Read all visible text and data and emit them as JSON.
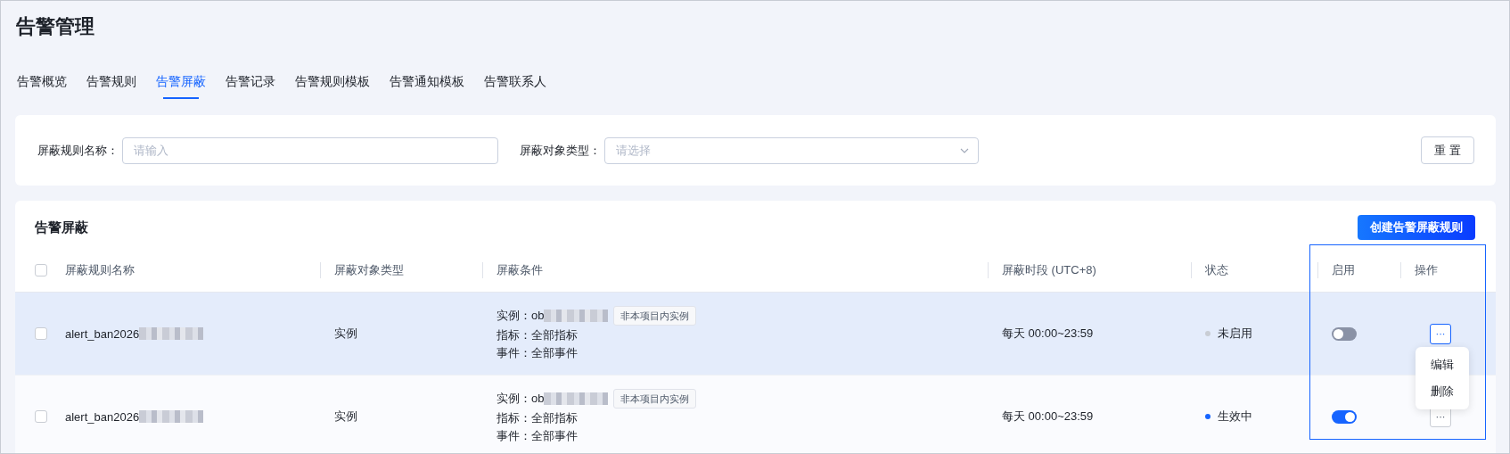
{
  "page_title": "告警管理",
  "tabs": [
    {
      "label": "告警概览",
      "selected": false
    },
    {
      "label": "告警规则",
      "selected": false
    },
    {
      "label": "告警屏蔽",
      "selected": true
    },
    {
      "label": "告警记录",
      "selected": false
    },
    {
      "label": "告警规则模板",
      "selected": false
    },
    {
      "label": "告警通知模板",
      "selected": false
    },
    {
      "label": "告警联系人",
      "selected": false
    }
  ],
  "filters": [
    {
      "kind": "input",
      "label": "屏蔽规则名称：",
      "placeholder": "请输入"
    },
    {
      "kind": "select",
      "label": "屏蔽对象类型：",
      "placeholder": "请选择"
    }
  ],
  "reset_button": "重 置",
  "table": {
    "title": "告警屏蔽",
    "create_button": "创建告警屏蔽规则",
    "select_all_checked": false,
    "highlight_frame": true,
    "columns": [
      "屏蔽规则名称",
      "屏蔽对象类型",
      "屏蔽条件",
      "屏蔽时段 (UTC+8)",
      "状态",
      "启用",
      "操作"
    ],
    "rows": [
      {
        "selected": true,
        "checked": false,
        "name": "alert_ban2026",
        "name_redacted": true,
        "type": "实例",
        "conditions": [
          {
            "label": "实例：",
            "value": "ob",
            "redacted": true,
            "tag": "非本项目内实例"
          },
          {
            "label": "指标：",
            "value": "全部指标",
            "redacted": false
          },
          {
            "label": "事件：",
            "value": "全部事件",
            "redacted": false
          }
        ],
        "period": "每天 00:00~23:59",
        "status": "未启用",
        "color": "#c9cdd4",
        "enabled": false,
        "actions": "···",
        "menu_open": true
      },
      {
        "selected": false,
        "checked": false,
        "name": "alert_ban2026",
        "name_redacted": true,
        "type": "实例",
        "conditions": [
          {
            "label": "实例：",
            "value": "ob",
            "redacted": true,
            "tag": "非本项目内实例"
          },
          {
            "label": "指标：",
            "value": "全部指标",
            "redacted": false
          },
          {
            "label": "事件：",
            "value": "全部事件",
            "redacted": false
          }
        ],
        "period": "每天 00:00~23:59",
        "status": "生效中",
        "color": "#1664ff",
        "enabled": true,
        "actions": "···",
        "menu_open": false
      }
    ],
    "action_menu": [
      "编辑",
      "删除"
    ]
  }
}
